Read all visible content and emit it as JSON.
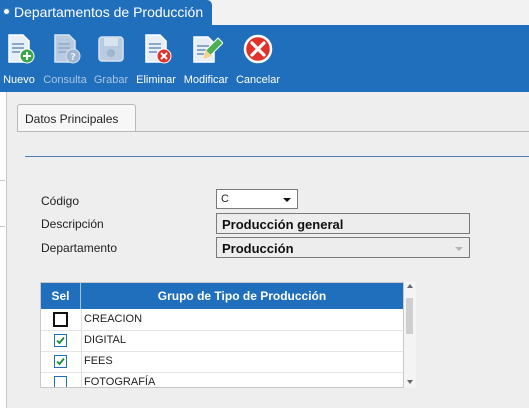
{
  "window": {
    "title": "Departamentos de Producción"
  },
  "toolbar": {
    "buttons": [
      {
        "label": "Nuevo",
        "icon": "new-document-icon",
        "enabled": true
      },
      {
        "label": "Consulta",
        "icon": "query-document-icon",
        "enabled": false
      },
      {
        "label": "Grabar",
        "icon": "save-disk-icon",
        "enabled": false
      },
      {
        "label": "Eliminar",
        "icon": "delete-document-icon",
        "enabled": true
      },
      {
        "label": "Modificar",
        "icon": "edit-pencil-icon",
        "enabled": true
      },
      {
        "label": "Cancelar",
        "icon": "cancel-x-icon",
        "enabled": true
      }
    ]
  },
  "tabs": {
    "active": "Datos Principales"
  },
  "form": {
    "codigo": {
      "label": "Código",
      "value": "C"
    },
    "descripcion": {
      "label": "Descripción",
      "value": "Producción general"
    },
    "departamento": {
      "label": "Departamento",
      "value": "Producción"
    }
  },
  "grid": {
    "columns": {
      "sel": "Sel",
      "grupo": "Grupo de Tipo de Producción"
    },
    "rows": [
      {
        "name": "CREACION",
        "checked": false
      },
      {
        "name": "DIGITAL",
        "checked": true
      },
      {
        "name": "FEES",
        "checked": true
      },
      {
        "name": "FOTOGRAFÍA",
        "checked": false
      }
    ]
  },
  "colors": {
    "accent": "#1f6fbd",
    "content_bg": "#eeeeee",
    "check": "#1a8a3a",
    "cancel_red": "#e0322a"
  }
}
